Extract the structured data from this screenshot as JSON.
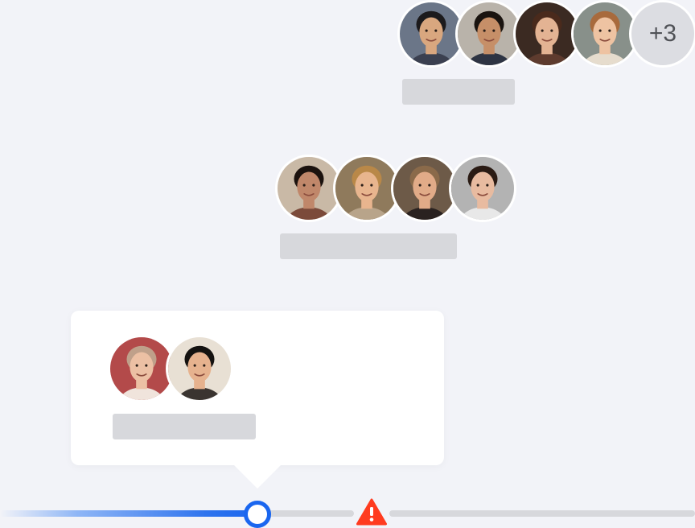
{
  "groups": [
    {
      "avatars": [
        {
          "name": "man-glasses",
          "bg": "#6b7688",
          "skin": "#d9a77f",
          "hair": "#1c1a1c",
          "shirt": "#3b4050"
        },
        {
          "name": "man-short-hair",
          "bg": "#b9b3aa",
          "skin": "#c68f68",
          "hair": "#1a1410",
          "shirt": "#2e3443"
        },
        {
          "name": "woman-dark-hair",
          "bg": "#3b2a22",
          "skin": "#e3b393",
          "hair": "#4a2a1c",
          "shirt": "#5e3b2e"
        },
        {
          "name": "woman-auburn-hair",
          "bg": "#88908a",
          "skin": "#eec3a2",
          "hair": "#a86a3c",
          "shirt": "#e6dccd"
        }
      ],
      "more_label": "+3"
    },
    {
      "avatars": [
        {
          "name": "woman-black-hair",
          "bg": "#c9b9a6",
          "skin": "#c0876a",
          "hair": "#1b120e",
          "shirt": "#7b4a3a"
        },
        {
          "name": "woman-blonde-hair",
          "bg": "#8f7a5c",
          "skin": "#e8b58e",
          "hair": "#b98848",
          "shirt": "#b8a48a"
        },
        {
          "name": "man-long-hair",
          "bg": "#6d5a48",
          "skin": "#e1ab88",
          "hair": "#8a6a4a",
          "shirt": "#2a2220"
        },
        {
          "name": "man-curly-hair",
          "bg": "#b3b3b3",
          "skin": "#e8bba0",
          "hair": "#2a1b14",
          "shirt": "#e8e8e8"
        }
      ]
    },
    {
      "avatars": [
        {
          "name": "woman-light-hair",
          "bg": "#b34a4a",
          "skin": "#ecc0a4",
          "hair": "#bfa08a",
          "shirt": "#f0e4dc"
        },
        {
          "name": "man-smiling",
          "bg": "#e8e0d4",
          "skin": "#e6b28e",
          "hair": "#141210",
          "shirt": "#3a3430"
        }
      ]
    }
  ],
  "timeline": {
    "progress_color": "#1a66ef",
    "warning_color": "#ff3b1f",
    "warning_icon": "warning-icon"
  }
}
